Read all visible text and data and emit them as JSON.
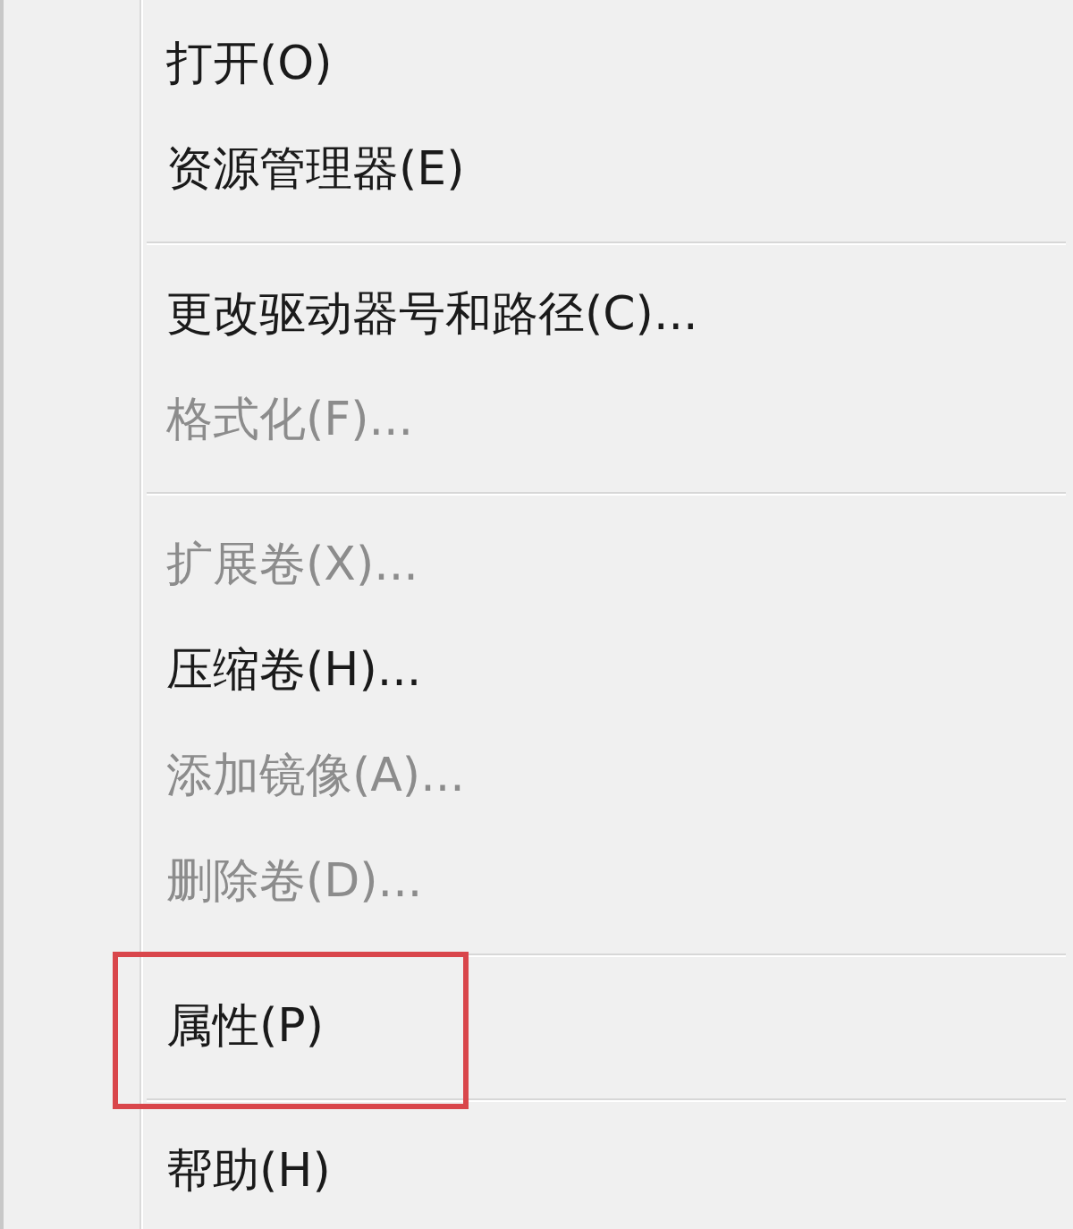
{
  "menu": {
    "groups": [
      {
        "items": [
          {
            "label": "打开(O)",
            "disabled": false,
            "highlighted": false
          },
          {
            "label": "资源管理器(E)",
            "disabled": false,
            "highlighted": false
          }
        ]
      },
      {
        "items": [
          {
            "label": "更改驱动器号和路径(C)...",
            "disabled": false,
            "highlighted": false
          },
          {
            "label": "格式化(F)...",
            "disabled": true,
            "highlighted": false
          }
        ]
      },
      {
        "items": [
          {
            "label": "扩展卷(X)...",
            "disabled": true,
            "highlighted": false
          },
          {
            "label": "压缩卷(H)...",
            "disabled": false,
            "highlighted": false
          },
          {
            "label": "添加镜像(A)...",
            "disabled": true,
            "highlighted": false
          },
          {
            "label": "删除卷(D)...",
            "disabled": true,
            "highlighted": false
          }
        ]
      },
      {
        "items": [
          {
            "label": "属性(P)",
            "disabled": false,
            "highlighted": true
          }
        ]
      },
      {
        "items": [
          {
            "label": "帮助(H)",
            "disabled": false,
            "highlighted": false
          }
        ]
      }
    ]
  }
}
